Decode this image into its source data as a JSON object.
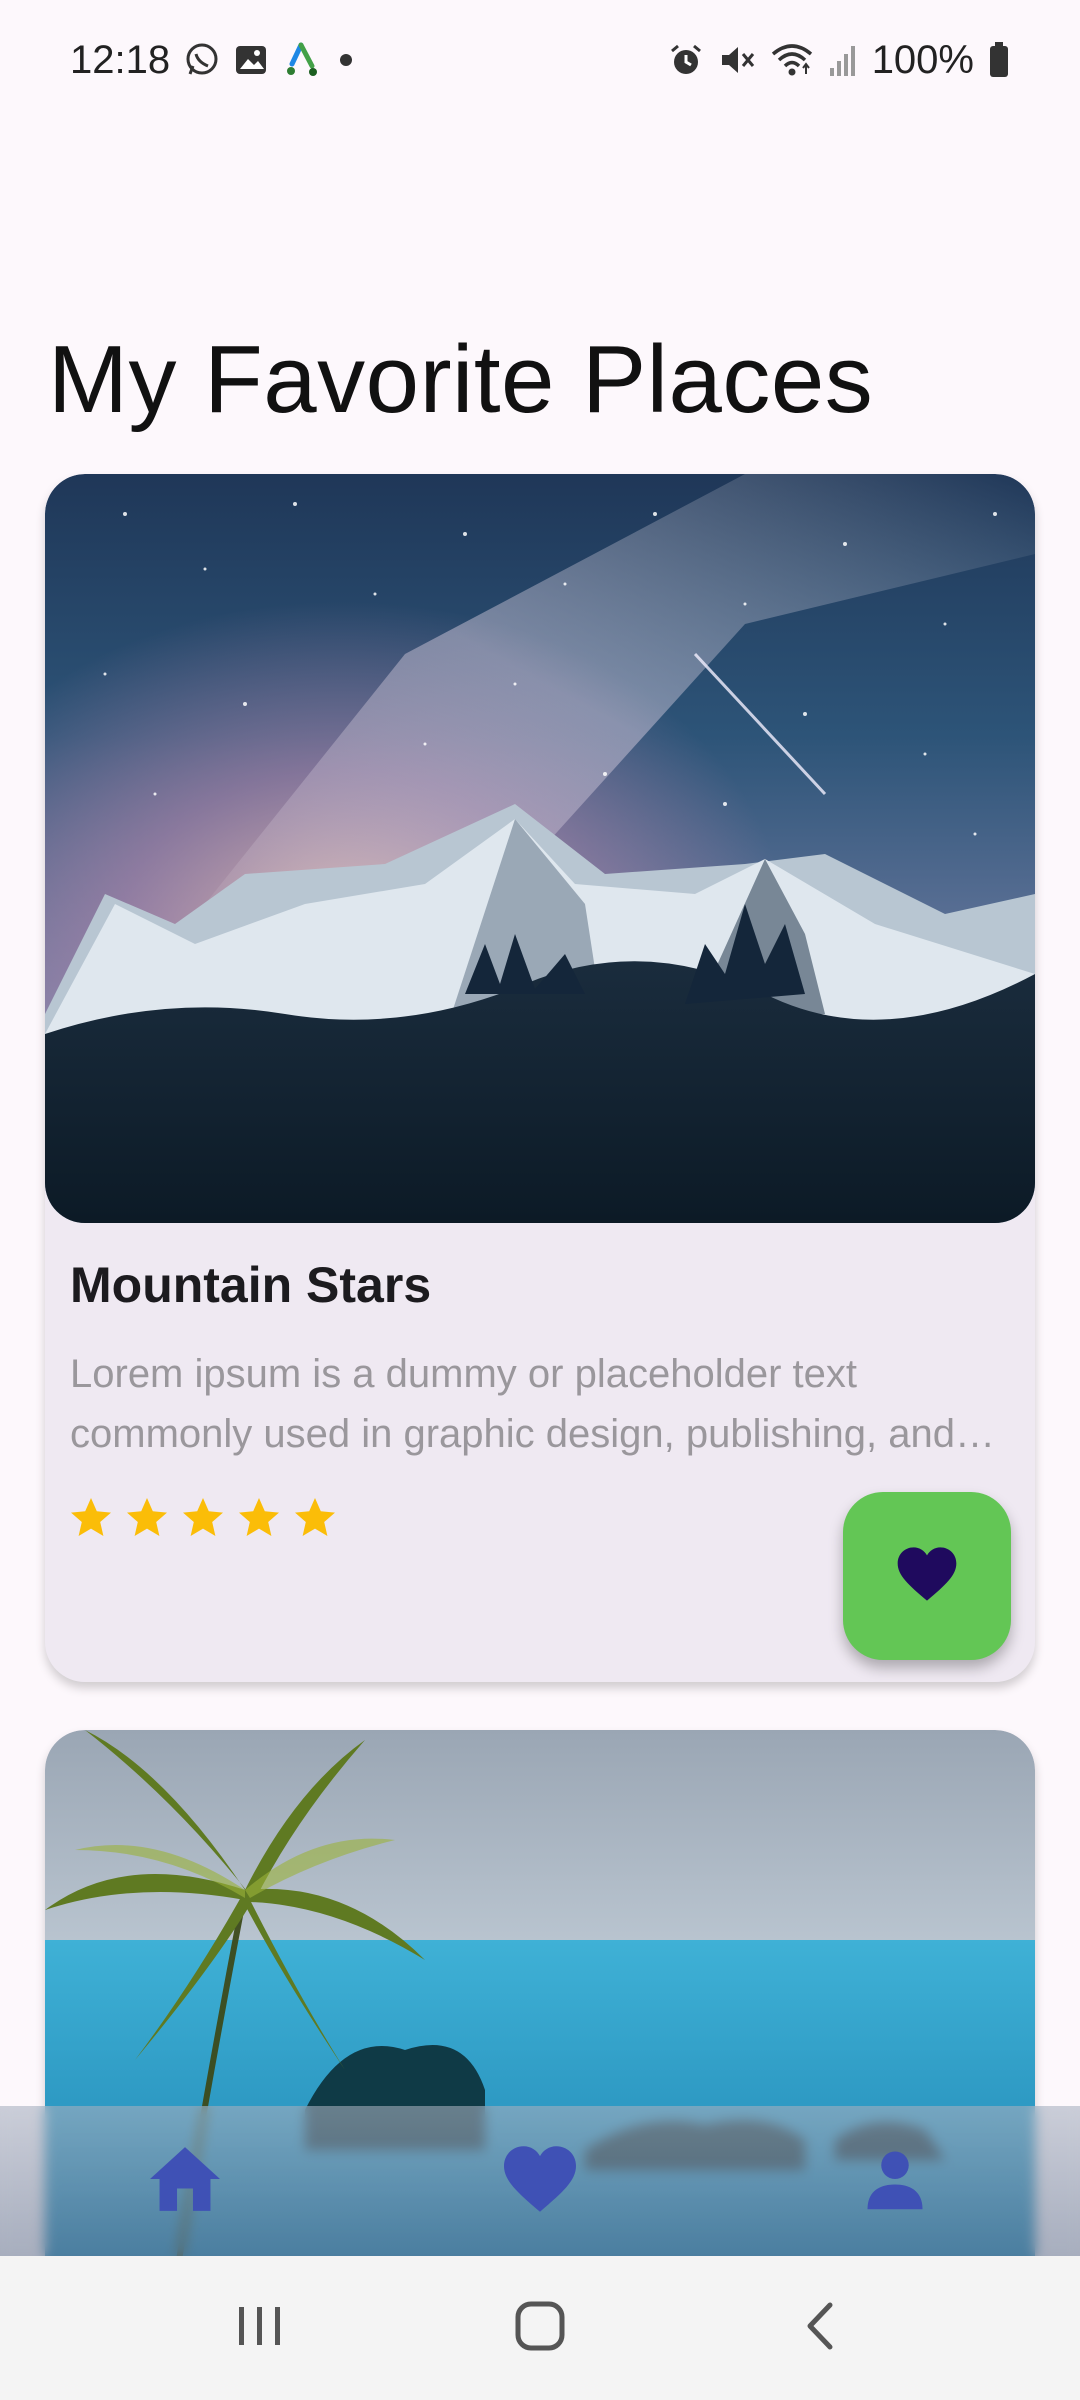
{
  "status_bar": {
    "time": "12:18",
    "battery": "100%",
    "left_icons": [
      "whatsapp-icon",
      "gallery-icon",
      "app-icon",
      "dot-icon"
    ],
    "right_icons": [
      "alarm-icon",
      "mute-icon",
      "wifi-icon",
      "signal-icon",
      "battery-icon"
    ]
  },
  "page": {
    "title": "My Favorite Places"
  },
  "cards": [
    {
      "title": "Mountain Stars",
      "description": "Lorem ipsum is a dummy or placeholder text commonly used in graphic design, publishing, and web development to fill empty spaces in a layout that do not yet have content.",
      "rating": 5,
      "favorite": true,
      "image": "mountains-night-sky"
    },
    {
      "image": "palm-tree-ocean"
    }
  ],
  "bottom_nav": {
    "items": [
      {
        "icon": "home-icon"
      },
      {
        "icon": "heart-icon"
      },
      {
        "icon": "person-icon"
      }
    ],
    "color": "#3f51b5"
  },
  "system_nav": {
    "items": [
      "recents-icon",
      "home-circle-icon",
      "back-icon"
    ]
  },
  "colors": {
    "fav_button_bg": "#63c655",
    "fav_heart": "#1f0a5e",
    "star": "#fbbd08",
    "card_bg": "#efe9f2"
  }
}
